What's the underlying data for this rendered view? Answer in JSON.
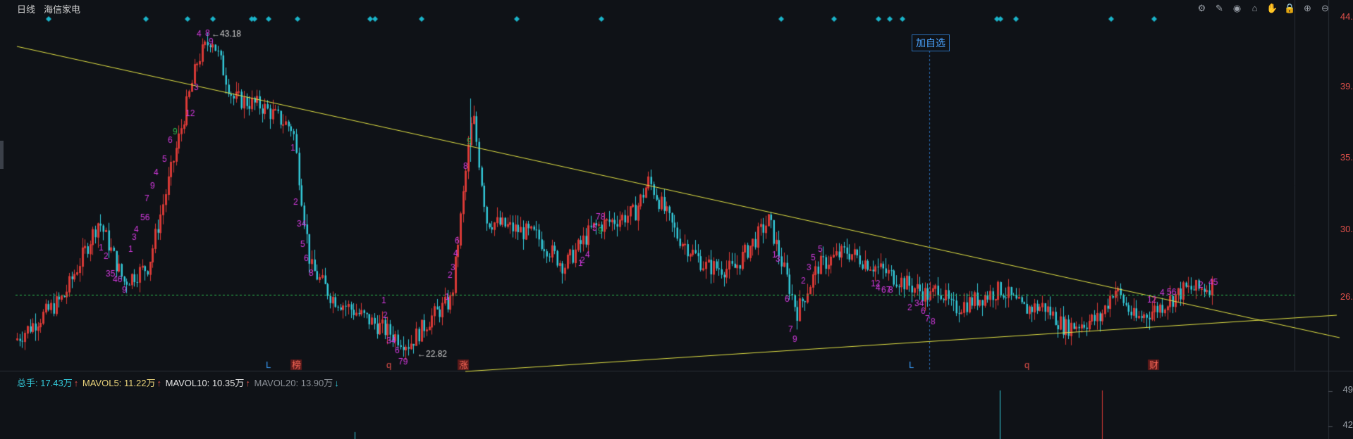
{
  "header": {
    "period": "日线",
    "stock_name": "海信家电"
  },
  "toolbar": [
    "settings-icon",
    "brush-icon",
    "eye-icon",
    "basket-icon",
    "hand-icon",
    "lock-icon",
    "zoom-in-icon",
    "zoom-out-icon"
  ],
  "add_watchlist_label": "加自选",
  "price_axis_labels": [
    "44.",
    "39.",
    "35.",
    "30.",
    "26."
  ],
  "volume_axis_labels": [
    "49",
    "42"
  ],
  "annotations": {
    "high": "43.18",
    "low": "22.82"
  },
  "volume_legend": {
    "total": "总手: 17.43万",
    "mavol5": "MAVOL5: 11.22万",
    "mavol10": "MAVOL10: 10.35万",
    "mavol20": "MAVOL20: 13.90万"
  },
  "event_markers": [
    "L",
    "榜",
    "q",
    "涨",
    "L",
    "q",
    "财"
  ],
  "colors": {
    "up": "#d93a36",
    "down": "#33c9d9",
    "trendline": "#e3e345",
    "marker": "#1ab3c9",
    "td_count": "#d43adf",
    "td_nine": "#2fbf4f",
    "current_price": "#2fbf4f"
  },
  "chart_data": {
    "type": "candlestick",
    "title": "海信家电 日线",
    "y_range": [
      21.5,
      44.5
    ],
    "current_price": 26.5,
    "high": 43.18,
    "low": 22.82
  }
}
